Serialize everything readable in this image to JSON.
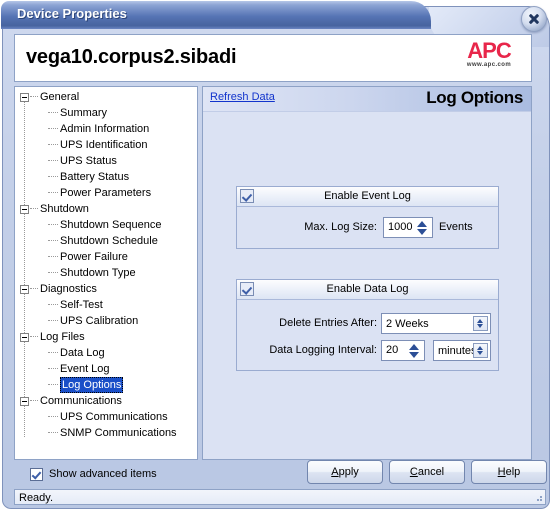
{
  "window": {
    "title": "Device Properties",
    "close_icon": "close-icon"
  },
  "header": {
    "device_name": "vega10.corpus2.sibadi",
    "logo_mark": "APC",
    "logo_url": "www.apc.com"
  },
  "tree": {
    "nodes": [
      {
        "label": "General",
        "level": 0,
        "expanded": true,
        "selected": false
      },
      {
        "label": "Summary",
        "level": 1,
        "selected": false
      },
      {
        "label": "Admin Information",
        "level": 1,
        "selected": false
      },
      {
        "label": "UPS Identification",
        "level": 1,
        "selected": false
      },
      {
        "label": "UPS Status",
        "level": 1,
        "selected": false
      },
      {
        "label": "Battery Status",
        "level": 1,
        "selected": false
      },
      {
        "label": "Power Parameters",
        "level": 1,
        "selected": false
      },
      {
        "label": "Shutdown",
        "level": 0,
        "expanded": true,
        "selected": false
      },
      {
        "label": "Shutdown Sequence",
        "level": 1,
        "selected": false
      },
      {
        "label": "Shutdown Schedule",
        "level": 1,
        "selected": false
      },
      {
        "label": "Power Failure",
        "level": 1,
        "selected": false
      },
      {
        "label": "Shutdown Type",
        "level": 1,
        "selected": false
      },
      {
        "label": "Diagnostics",
        "level": 0,
        "expanded": true,
        "selected": false
      },
      {
        "label": "Self-Test",
        "level": 1,
        "selected": false
      },
      {
        "label": "UPS Calibration",
        "level": 1,
        "selected": false
      },
      {
        "label": "Log Files",
        "level": 0,
        "expanded": true,
        "selected": false
      },
      {
        "label": "Data Log",
        "level": 1,
        "selected": false
      },
      {
        "label": "Event Log",
        "level": 1,
        "selected": false
      },
      {
        "label": "Log Options",
        "level": 1,
        "selected": true
      },
      {
        "label": "Communications",
        "level": 0,
        "expanded": true,
        "selected": false
      },
      {
        "label": "UPS Communications",
        "level": 1,
        "selected": false
      },
      {
        "label": "SNMP Communications",
        "level": 1,
        "selected": false
      }
    ]
  },
  "content": {
    "refresh_link": "Refresh Data",
    "page_title": "Log Options",
    "event_log": {
      "title": "Enable Event Log",
      "enabled": true,
      "max_log_size_label": "Max. Log Size:",
      "max_log_size_value": "1000",
      "max_log_size_units": "Events"
    },
    "data_log": {
      "title": "Enable Data Log",
      "enabled": true,
      "delete_after_label": "Delete Entries After:",
      "delete_after_value": "2 Weeks",
      "interval_label": "Data Logging Interval:",
      "interval_value": "20",
      "interval_units": "minutes"
    }
  },
  "footer": {
    "show_advanced_label": "Show advanced items",
    "show_advanced_checked": true,
    "apply_label": "Apply",
    "cancel_label": "Cancel",
    "help_label": "Help"
  },
  "statusbar": {
    "text": "Ready."
  },
  "colors": {
    "title_bar_blue": "#4c6aa8",
    "window_bg": "#c3cfe8",
    "panel_bg": "#dbe2f3",
    "selection_blue": "#1a4fc8",
    "link_blue": "#1234cc",
    "apc_red": "#e8264a"
  }
}
